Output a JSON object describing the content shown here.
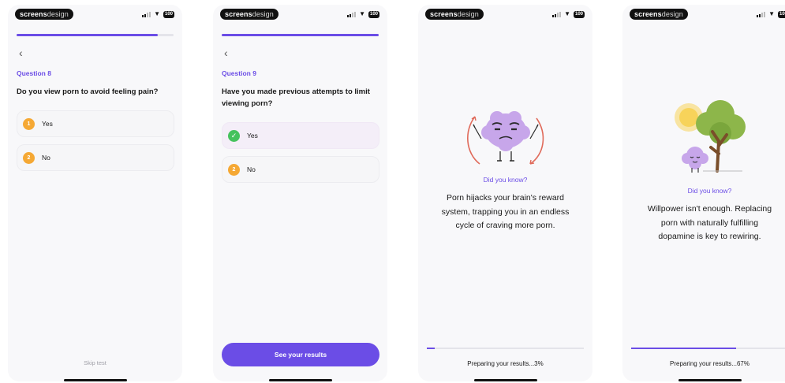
{
  "brand": {
    "bold": "screens",
    "light": "design"
  },
  "status": {
    "battery": "100"
  },
  "screens": [
    {
      "progress": 0.9,
      "question_number": "Question 8",
      "question": "Do you view porn to avoid feeling pain?",
      "options": [
        {
          "index": "1",
          "label": "Yes"
        },
        {
          "index": "2",
          "label": "No"
        }
      ],
      "skip_label": "Skip test"
    },
    {
      "progress": 1.0,
      "question_number": "Question 9",
      "question": "Have you made previous attempts to limit viewing porn?",
      "options": [
        {
          "index": "1",
          "label": "Yes",
          "selected": true
        },
        {
          "index": "2",
          "label": "No"
        }
      ],
      "cta_label": "See your results"
    },
    {
      "did_you_know": "Did you know?",
      "fact": "Porn hijacks your brain's reward system, trapping you in an endless cycle of craving more porn.",
      "loading_progress": 0.03,
      "loading_text": "Preparing your results...3%"
    },
    {
      "did_you_know": "Did you know?",
      "fact": "Willpower isn't enough. Replacing porn with naturally fulfilling dopamine is key to rewiring.",
      "loading_progress": 0.67,
      "loading_text": "Preparing your results...67%"
    }
  ],
  "colors": {
    "accent": "#6b4de6",
    "badge": "#f5a834",
    "check": "#45c25d",
    "brain": "#c7a6ea",
    "tree": "#8db64a",
    "sun": "#f7d35a"
  }
}
